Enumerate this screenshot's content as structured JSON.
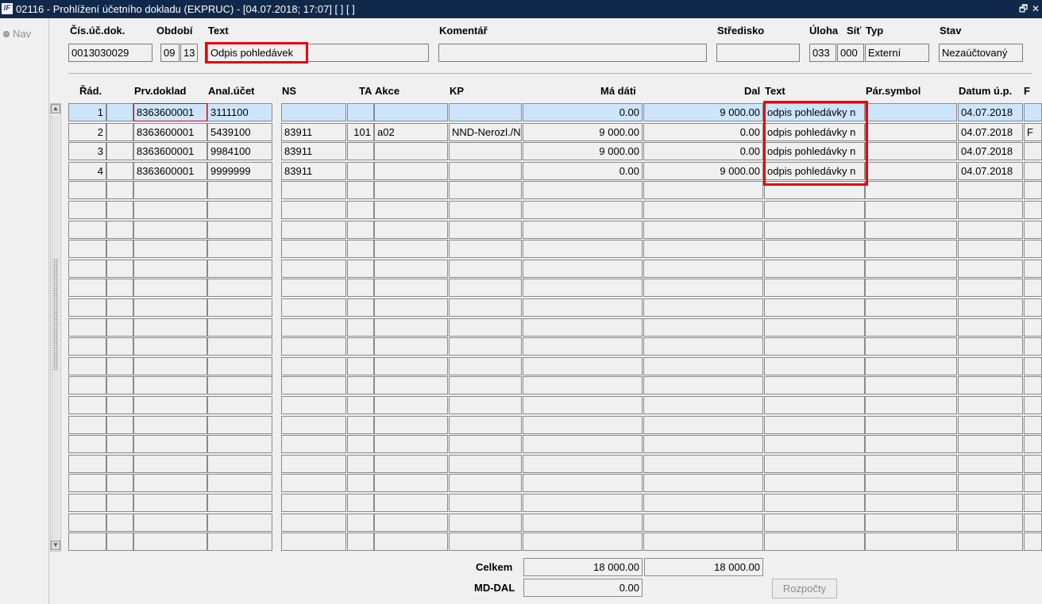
{
  "window": {
    "title": "02116 - Prohlížení účetního dokladu (EKPRUC) - [04.07.2018; 17:07]  [ ]  [ ]",
    "icon": "IF",
    "restore_glyph": "🗗",
    "close_glyph": "✕"
  },
  "nav": {
    "label": "Nav"
  },
  "header": {
    "labels": {
      "doc_number": "Čís.úč.dok.",
      "period": "Období",
      "text": "Text",
      "comment": "Komentář",
      "center": "Středisko",
      "task": "Úloha",
      "network": "Síť",
      "type": "Typ",
      "status": "Stav"
    },
    "values": {
      "doc_number": "0013030029",
      "period_month": "09",
      "period_year": "13",
      "text": "Odpis pohledávek",
      "comment": "",
      "center": "",
      "task": "033",
      "network": "000",
      "type": "Externí",
      "status": "Nezaúčtovaný"
    }
  },
  "table": {
    "columns": [
      "Řád.",
      "Prv.doklad",
      "Anal.účet",
      "NS",
      "TA",
      "Akce",
      "KP",
      "Má dáti",
      "Dal",
      "Text",
      "Pár.symbol",
      "Datum ú.p.",
      "F"
    ],
    "rows": [
      [
        "1",
        "",
        "8363600001",
        "3111100",
        "",
        "",
        "",
        "",
        "0.00",
        "9 000.00",
        "odpis pohledávky n",
        "",
        "04.07.2018",
        ""
      ],
      [
        "2",
        "",
        "8363600001",
        "5439100",
        "83911",
        "101",
        "a02",
        "NND-Nerozl./N",
        "9 000.00",
        "0.00",
        "odpis pohledávky n",
        "",
        "04.07.2018",
        "F"
      ],
      [
        "3",
        "",
        "8363600001",
        "9984100",
        "83911",
        "",
        "",
        "",
        "9 000.00",
        "0.00",
        "odpis pohledávky n",
        "",
        "04.07.2018",
        ""
      ],
      [
        "4",
        "",
        "8363600001",
        "9999999",
        "83911",
        "",
        "",
        "",
        "0.00",
        "9 000.00",
        "odpis pohledávky n",
        "",
        "04.07.2018",
        ""
      ]
    ],
    "empty_row_count": 19,
    "scroll_up_glyph": "▲",
    "scroll_down_glyph": "▼"
  },
  "footer": {
    "total_label": "Celkem",
    "total_debit": "18 000.00",
    "total_credit": "18 000.00",
    "diff_label": "MD-DAL",
    "diff_value": "0.00",
    "budgets_button": "Rozpočty"
  },
  "colors": {
    "title_bar": "#10284a",
    "highlight_red": "#e8000f",
    "selected_row": "#cce5fb"
  }
}
